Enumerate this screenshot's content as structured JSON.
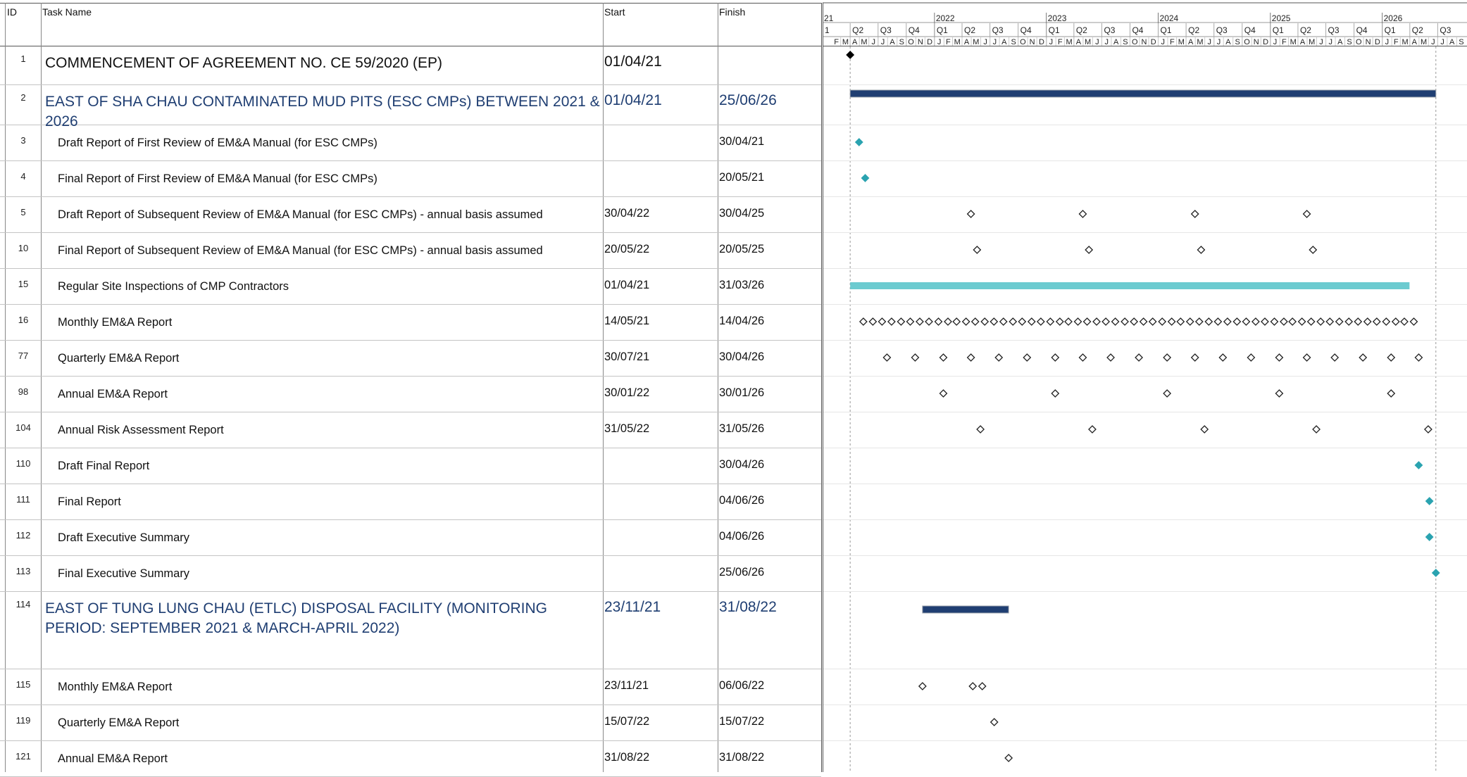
{
  "columns": {
    "id": "ID",
    "name": "Task Name",
    "start": "Start",
    "finish": "Finish"
  },
  "rows": [
    {
      "id": "1",
      "name": "COMMENCEMENT OF AGREEMENT NO. CE 59/2020 (EP)",
      "start": "01/04/21",
      "finish": "",
      "level": 0,
      "kind": "milestone-black",
      "dates": [
        "2021-04-01"
      ]
    },
    {
      "id": "2",
      "name": "EAST OF SHA CHAU CONTAMINATED MUD PITS (ESC CMPs) BETWEEN 2021 & 2026",
      "start": "01/04/21",
      "finish": "25/06/26",
      "level": 1,
      "kind": "summary",
      "dates": [
        "2021-04-01",
        "2026-06-25"
      ]
    },
    {
      "id": "3",
      "name": "Draft Report of First Review of EM&A Manual (for ESC CMPs)",
      "start": "",
      "finish": "30/04/21",
      "level": 2,
      "kind": "milestone-teal",
      "dates": [
        "2021-04-30"
      ]
    },
    {
      "id": "4",
      "name": "Final Report of First Review of EM&A Manual (for ESC CMPs)",
      "start": "",
      "finish": "20/05/21",
      "level": 2,
      "kind": "milestone-teal",
      "dates": [
        "2021-05-20"
      ]
    },
    {
      "id": "5",
      "name": "Draft Report of Subsequent Review of EM&A Manual (for ESC CMPs) - annual basis assumed",
      "start": "30/04/22",
      "finish": "30/04/25",
      "level": 2,
      "kind": "recurring",
      "dates": [
        "2022-04-30",
        "2023-04-30",
        "2024-04-30",
        "2025-04-30"
      ]
    },
    {
      "id": "10",
      "name": "Final Report of Subsequent Review of EM&A Manual (for ESC CMPs) - annual basis assumed",
      "start": "20/05/22",
      "finish": "20/05/25",
      "level": 2,
      "kind": "recurring",
      "dates": [
        "2022-05-20",
        "2023-05-20",
        "2024-05-20",
        "2025-05-20"
      ]
    },
    {
      "id": "15",
      "name": "Regular Site Inspections of CMP Contractors",
      "start": "01/04/21",
      "finish": "31/03/26",
      "level": 2,
      "kind": "task",
      "dates": [
        "2021-04-01",
        "2026-03-31"
      ]
    },
    {
      "id": "16",
      "name": "Monthly EM&A Report",
      "start": "14/05/21",
      "finish": "14/04/26",
      "level": 2,
      "kind": "recurring-monthly",
      "dates": [
        "2021-05-14",
        "2026-04-14"
      ]
    },
    {
      "id": "77",
      "name": "Quarterly EM&A Report",
      "start": "30/07/21",
      "finish": "30/04/26",
      "level": 2,
      "kind": "recurring-quarterly",
      "dates": [
        "2021-07-30",
        "2026-04-30"
      ]
    },
    {
      "id": "98",
      "name": "Annual EM&A Report",
      "start": "30/01/22",
      "finish": "30/01/26",
      "level": 2,
      "kind": "recurring",
      "dates": [
        "2022-01-30",
        "2023-01-30",
        "2024-01-30",
        "2025-01-30",
        "2026-01-30"
      ]
    },
    {
      "id": "104",
      "name": "Annual Risk Assessment Report",
      "start": "31/05/22",
      "finish": "31/05/26",
      "level": 2,
      "kind": "recurring",
      "dates": [
        "2022-05-31",
        "2023-05-31",
        "2024-05-31",
        "2025-05-31",
        "2026-05-31"
      ]
    },
    {
      "id": "110",
      "name": "Draft Final Report",
      "start": "",
      "finish": "30/04/26",
      "level": 2,
      "kind": "milestone-teal",
      "dates": [
        "2026-04-30"
      ]
    },
    {
      "id": "111",
      "name": "Final Report",
      "start": "",
      "finish": "04/06/26",
      "level": 2,
      "kind": "milestone-teal",
      "dates": [
        "2026-06-04"
      ]
    },
    {
      "id": "112",
      "name": "Draft Executive Summary",
      "start": "",
      "finish": "04/06/26",
      "level": 2,
      "kind": "milestone-teal",
      "dates": [
        "2026-06-04"
      ]
    },
    {
      "id": "113",
      "name": "Final Executive Summary",
      "start": "",
      "finish": "25/06/26",
      "level": 2,
      "kind": "milestone-teal",
      "dates": [
        "2026-06-25"
      ]
    },
    {
      "id": "114",
      "name": "EAST OF TUNG LUNG CHAU (ETLC) DISPOSAL FACILITY (MONITORING PERIOD: SEPTEMBER 2021 & MARCH-APRIL 2022)",
      "start": "23/11/21",
      "finish": "31/08/22",
      "level": 1,
      "kind": "summary",
      "dates": [
        "2021-11-23",
        "2022-08-31"
      ]
    },
    {
      "id": "115",
      "name": "Monthly EM&A Report",
      "start": "23/11/21",
      "finish": "06/06/22",
      "level": 2,
      "kind": "recurring",
      "dates": [
        "2021-11-23",
        "2022-05-06",
        "2022-06-06"
      ]
    },
    {
      "id": "119",
      "name": "Quarterly EM&A Report",
      "start": "15/07/22",
      "finish": "15/07/22",
      "level": 2,
      "kind": "recurring",
      "dates": [
        "2022-07-15"
      ]
    },
    {
      "id": "121",
      "name": "Annual EM&A Report",
      "start": "31/08/22",
      "finish": "31/08/22",
      "level": 2,
      "kind": "recurring",
      "dates": [
        "2022-08-31"
      ]
    }
  ],
  "chart_data": {
    "type": "gantt",
    "x_range": [
      "2021-01-01",
      "2026-09-30"
    ],
    "timescale_years": [
      "21",
      "2022",
      "2023",
      "2024",
      "2025",
      "2026"
    ],
    "timescale_quarters": [
      "1",
      "Q2",
      "Q3",
      "Q4",
      "Q1",
      "Q2",
      "Q3",
      "Q4",
      "Q1",
      "Q2",
      "Q3",
      "Q4",
      "Q1",
      "Q2",
      "Q3",
      "Q4",
      "Q1",
      "Q2",
      "Q3",
      "Q4",
      "Q1",
      "Q2",
      "Q3"
    ],
    "timescale_months": [
      "F",
      "M",
      "A",
      "M",
      "J",
      "J",
      "A",
      "S",
      "O",
      "N",
      "D",
      "J",
      "F",
      "M",
      "A",
      "M",
      "J",
      "J",
      "A",
      "S",
      "O",
      "N",
      "D",
      "J",
      "F",
      "M",
      "A",
      "M",
      "J",
      "J",
      "A",
      "S",
      "O",
      "N",
      "D",
      "J",
      "F",
      "M",
      "A",
      "M",
      "J",
      "J",
      "A",
      "S",
      "O",
      "N",
      "D",
      "J",
      "F",
      "M",
      "A",
      "M",
      "J",
      "J",
      "A",
      "S",
      "O",
      "N",
      "D",
      "J",
      "F",
      "M",
      "A",
      "M",
      "J",
      "J",
      "A",
      "S"
    ],
    "colors": {
      "summary": "#1f3e72",
      "task": "#6ccbd0",
      "milestone_teal": "#2aa3b0",
      "milestone_black": "#000000",
      "milestone_outline": "#222222"
    }
  }
}
